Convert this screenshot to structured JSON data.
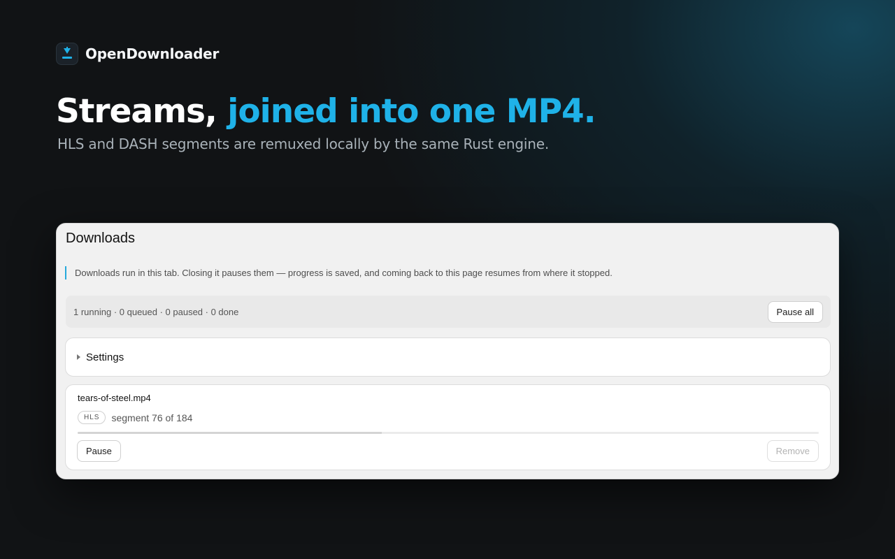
{
  "brand": {
    "name": "OpenDownloader",
    "icon": "download-icon"
  },
  "hero": {
    "headline_prefix": "Streams, ",
    "headline_accent": "joined into one MP4.",
    "subline": "HLS and DASH segments are remuxed locally by the same Rust engine."
  },
  "colors": {
    "accent": "#1fb2e8",
    "notice_bar": "#25a9dc"
  },
  "panel": {
    "title": "Downloads",
    "notice": "Downloads run in this tab. Closing it pauses them — progress is saved, and coming back to this page resumes from where it stopped.",
    "status": "1 running · 0 queued · 0 paused · 0 done",
    "pause_all_label": "Pause all",
    "settings_label": "Settings"
  },
  "downloads": [
    {
      "filename": "tears-of-steel.mp4",
      "type": "HLS",
      "progress_text": "segment 76 of 184",
      "progress_fraction": 0.41,
      "pause_label": "Pause",
      "remove_label": "Remove"
    }
  ]
}
